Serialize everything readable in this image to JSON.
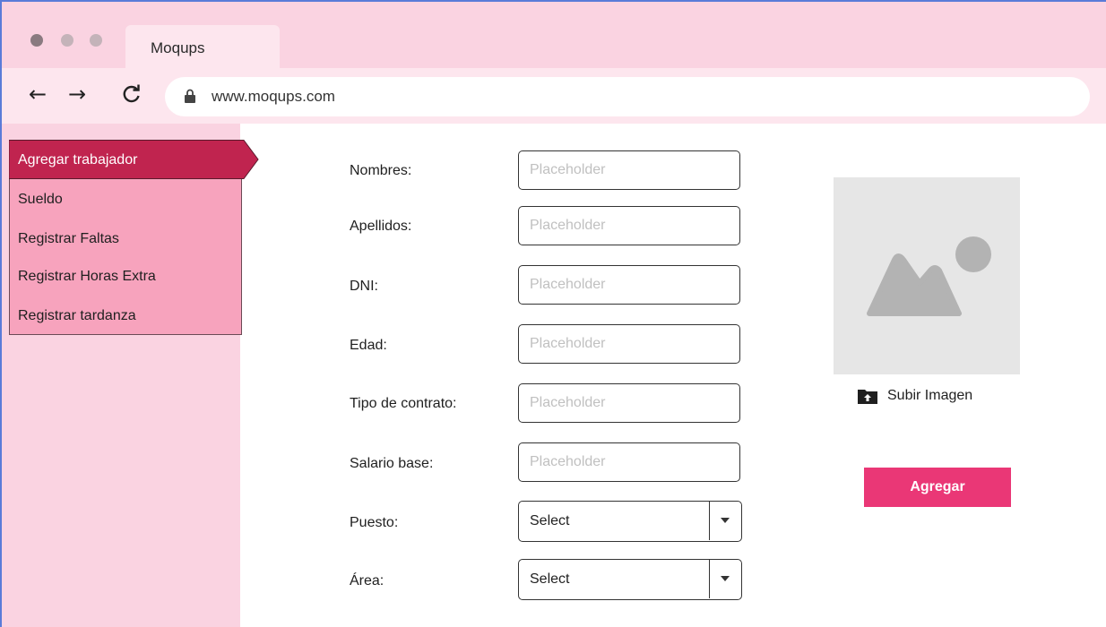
{
  "browser": {
    "tab_title": "Moqups",
    "url": "www.moqups.com",
    "icons": [
      "back-arrow-icon",
      "forward-arrow-icon",
      "reload-icon",
      "lock-icon"
    ]
  },
  "sidebar": {
    "items": [
      {
        "label": "Agregar trabajador",
        "active": true
      },
      {
        "label": "Sueldo"
      },
      {
        "label": "Registrar Faltas"
      },
      {
        "label": "Registrar Horas Extra"
      },
      {
        "label": "Registrar tardanza"
      }
    ]
  },
  "form": {
    "fields": [
      {
        "label": "Nombres:",
        "placeholder": "Placeholder"
      },
      {
        "label": "Apellidos:",
        "placeholder": "Placeholder"
      },
      {
        "label": "DNI:",
        "placeholder": "Placeholder"
      },
      {
        "label": "Edad:",
        "placeholder": "Placeholder"
      },
      {
        "label": "Tipo de contrato:",
        "placeholder": "Placeholder"
      },
      {
        "label": "Salario base:",
        "placeholder": "Placeholder"
      }
    ],
    "selects": [
      {
        "label": "Puesto:",
        "value": "Select"
      },
      {
        "label": "Área:",
        "value": "Select"
      }
    ]
  },
  "image_panel": {
    "upload_label": "Subir Imagen",
    "icon": "image-placeholder-icon"
  },
  "actions": {
    "add_label": "Agregar"
  },
  "colors": {
    "chrome_bg": "#fad3e1",
    "menu_bg": "#f7a3bd",
    "menu_active": "#c0244f",
    "button": "#ea3776"
  }
}
